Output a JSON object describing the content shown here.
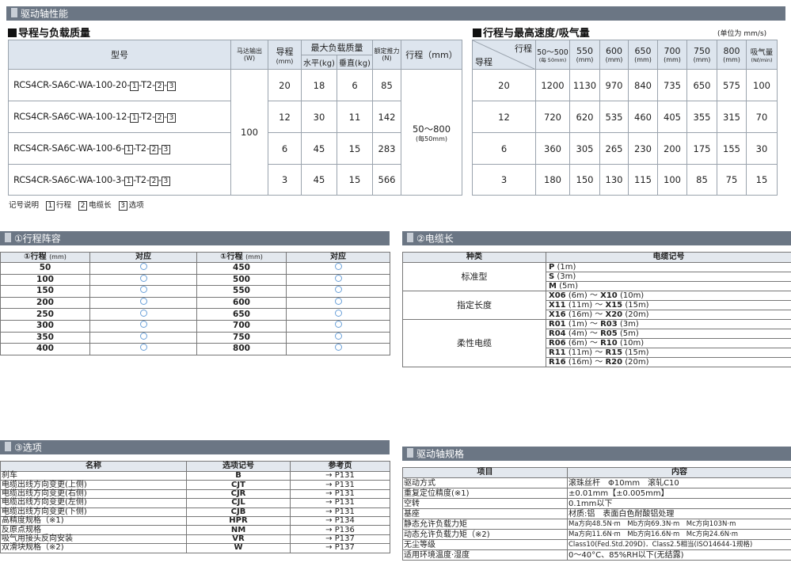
{
  "section_main": {
    "title": "驱动轴性能"
  },
  "guide": {
    "heading": "导程与负载质量",
    "headers": {
      "model": "型号",
      "motor": "马达输出",
      "motor_unit": "(W)",
      "lead": "导程",
      "lead_unit": "(mm)",
      "maxload": "最大负载质量",
      "horiz": "水平(kg)",
      "vert": "垂直(kg)",
      "thrust": "额定推力",
      "thrust_unit": "(N)",
      "stroke": "行程（mm）"
    },
    "motor_value": "100",
    "stroke_value": "50～800",
    "stroke_note": "(每50mm)",
    "rows": [
      {
        "model": "RCS4CR-SA6C-WA-100-20-",
        "lead": "20",
        "horiz": "18",
        "vert": "6",
        "thrust": "85"
      },
      {
        "model": "RCS4CR-SA6C-WA-100-12-",
        "lead": "12",
        "horiz": "30",
        "vert": "11",
        "thrust": "142"
      },
      {
        "model": "RCS4CR-SA6C-WA-100-6-",
        "lead": "6",
        "horiz": "45",
        "vert": "15",
        "thrust": "283"
      },
      {
        "model": "RCS4CR-SA6C-WA-100-3-",
        "lead": "3",
        "horiz": "45",
        "vert": "15",
        "thrust": "566"
      }
    ],
    "suffix": {
      "b1": "1",
      "t2": "-T2-",
      "b2": "2",
      "b3": "3",
      "dash": "-"
    },
    "legend": {
      "title": "记号说明",
      "k1": "1",
      "v1": "行程",
      "k2": "2",
      "v2": "电缆长",
      "k3": "3",
      "v3": "选项"
    }
  },
  "speed": {
    "heading": "行程与最高速度/吸气量",
    "unit": "(单位为 mm/s)",
    "corner_stroke": "行程",
    "corner_lead": "导程",
    "cols": [
      {
        "top": "50～500",
        "sub": "(每 50mm)"
      },
      {
        "top": "550",
        "sub": "(mm)"
      },
      {
        "top": "600",
        "sub": "(mm)"
      },
      {
        "top": "650",
        "sub": "(mm)"
      },
      {
        "top": "700",
        "sub": "(mm)"
      },
      {
        "top": "750",
        "sub": "(mm)"
      },
      {
        "top": "800",
        "sub": "(mm)"
      },
      {
        "top": "吸气量",
        "sub": "(Nℓ/min)"
      }
    ],
    "rows": [
      {
        "lead": "20",
        "v": [
          "1200",
          "1130",
          "970",
          "840",
          "735",
          "650",
          "575",
          "100"
        ]
      },
      {
        "lead": "12",
        "v": [
          "720",
          "620",
          "535",
          "460",
          "405",
          "355",
          "315",
          "70"
        ]
      },
      {
        "lead": "6",
        "v": [
          "360",
          "305",
          "265",
          "230",
          "200",
          "175",
          "155",
          "30"
        ]
      },
      {
        "lead": "3",
        "v": [
          "180",
          "150",
          "130",
          "115",
          "100",
          "85",
          "75",
          "15"
        ]
      }
    ]
  },
  "stroke_list": {
    "title": "①行程阵容",
    "h_stroke": "①行程",
    "h_unit": "(mm)",
    "h_support": "对应",
    "left": [
      "50",
      "100",
      "150",
      "200",
      "250",
      "300",
      "350",
      "400"
    ],
    "right": [
      "450",
      "500",
      "550",
      "600",
      "650",
      "700",
      "750",
      "800"
    ]
  },
  "cable": {
    "title": "②电缆长",
    "h_type": "种类",
    "h_code": "电缆记号",
    "groups": [
      {
        "name": "标准型",
        "items": [
          {
            "code": "P",
            "len": "(1m)"
          },
          {
            "code": "S",
            "len": "(3m)"
          },
          {
            "code": "M",
            "len": "(5m)"
          }
        ]
      },
      {
        "name": "指定长度",
        "items": [
          {
            "code": "X06",
            "len": "(6m)",
            "sep": "～",
            "code2": "X10",
            "len2": "(10m)"
          },
          {
            "code": "X11",
            "len": "(11m)",
            "sep": "～",
            "code2": "X15",
            "len2": "(15m)"
          },
          {
            "code": "X16",
            "len": "(16m)",
            "sep": "～",
            "code2": "X20",
            "len2": "(20m)"
          }
        ]
      },
      {
        "name": "柔性电缆",
        "items": [
          {
            "code": "R01",
            "len": "(1m)",
            "sep": "～",
            "code2": "R03",
            "len2": "(3m)"
          },
          {
            "code": "R04",
            "len": "(4m)",
            "sep": "～",
            "code2": "R05",
            "len2": "(5m)"
          },
          {
            "code": "R06",
            "len": "(6m)",
            "sep": "～",
            "code2": "R10",
            "len2": "(10m)"
          },
          {
            "code": "R11",
            "len": "(11m)",
            "sep": "～",
            "code2": "R15",
            "len2": "(15m)"
          },
          {
            "code": "R16",
            "len": "(16m)",
            "sep": "～",
            "code2": "R20",
            "len2": "(20m)"
          }
        ]
      }
    ]
  },
  "options": {
    "title": "③选项",
    "h_name": "名称",
    "h_code": "选项记号",
    "h_ref": "参考页",
    "rows": [
      {
        "name": "刹车",
        "code": "B",
        "ref": "→ P131"
      },
      {
        "name": "电缆出线方向变更(上侧)",
        "code": "CJT",
        "ref": "→ P131"
      },
      {
        "name": "电缆出线方向变更(右侧)",
        "code": "CJR",
        "ref": "→ P131"
      },
      {
        "name": "电缆出线方向变更(左侧)",
        "code": "CJL",
        "ref": "→ P131"
      },
      {
        "name": "电缆出线方向变更(下侧)",
        "code": "CJB",
        "ref": "→ P131"
      },
      {
        "name": "高精度规格（※1)",
        "code": "HPR",
        "ref": "→ P134"
      },
      {
        "name": "反原点规格",
        "code": "NM",
        "ref": "→ P136"
      },
      {
        "name": "吸气用接头反向安装",
        "code": "VR",
        "ref": "→ P137"
      },
      {
        "name": "双滑块规格（※2)",
        "code": "W",
        "ref": "→ P137"
      }
    ]
  },
  "specs": {
    "title": "驱动轴规格",
    "h_item": "项目",
    "h_content": "内容",
    "rows": [
      {
        "item": "驱动方式",
        "content": "滚珠丝杆　Φ10mm　滚轧C10"
      },
      {
        "item": "重复定位精度(※1)",
        "content": "±0.01mm【±0.005mm】"
      },
      {
        "item": "空转",
        "content": "0.1mm以下"
      },
      {
        "item": "基座",
        "content": "材质:铝　表面白色耐酸铝处理"
      },
      {
        "item": "静态允许负载力矩",
        "content": "Ma方向48.5N·m　Mb方向69.3N·m　Mc方向103N·m"
      },
      {
        "item": "动态允许负载力矩（※2)",
        "content": "Ma方向11.6N·m　Mb方向16.6N·m　Mc方向24.6N·m"
      },
      {
        "item": "无尘等级",
        "content": "Class10(Fed.Std.209D)．Class2.5相当(ISO14644-1规格)"
      },
      {
        "item": "适用环境温度·湿度",
        "content": "0～40°C、85%RH以下(无结露)"
      }
    ]
  }
}
